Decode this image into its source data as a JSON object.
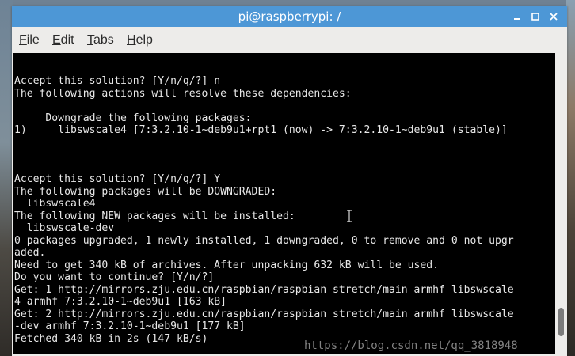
{
  "window": {
    "title": "pi@raspberrypi: /"
  },
  "menu": {
    "items": [
      {
        "mnemonic": "F",
        "rest": "ile"
      },
      {
        "mnemonic": "E",
        "rest": "dit"
      },
      {
        "mnemonic": "T",
        "rest": "abs"
      },
      {
        "mnemonic": "H",
        "rest": "elp"
      }
    ]
  },
  "terminal": {
    "lines": [
      "Accept this solution? [Y/n/q/?] n",
      "The following actions will resolve these dependencies:",
      "",
      "     Downgrade the following packages:",
      "1)     libswscale4 [7:3.2.10-1~deb9u1+rpt1 (now) -> 7:3.2.10-1~deb9u1 (stable)]",
      "",
      "",
      "",
      "Accept this solution? [Y/n/q/?] Y",
      "The following packages will be DOWNGRADED:",
      "  libswscale4",
      "The following NEW packages will be installed:",
      "  libswscale-dev",
      "0 packages upgraded, 1 newly installed, 1 downgraded, 0 to remove and 0 not upgr",
      "aded.",
      "Need to get 340 kB of archives. After unpacking 632 kB will be used.",
      "Do you want to continue? [Y/n/?]",
      "Get: 1 http://mirrors.zju.edu.cn/raspbian/raspbian stretch/main armhf libswscale",
      "4 armhf 7:3.2.10-1~deb9u1 [163 kB]",
      "Get: 2 http://mirrors.zju.edu.cn/raspbian/raspbian stretch/main armhf libswscale",
      "-dev armhf 7:3.2.10-1~deb9u1 [177 kB]",
      "Fetched 340 kB in 2s (147 kB/s)"
    ],
    "scroll_position": 0.95
  },
  "watermark": {
    "text": "https://blog.csdn.net/qq_3818948"
  },
  "colors": {
    "titlebar": "#4d97d6",
    "terminal_bg": "#000000",
    "terminal_fg": "#e8e8e8"
  },
  "icons": {
    "minimize": "minimize-icon",
    "maximize": "maximize-icon",
    "close": "close-icon",
    "cursor": "text-cursor-icon"
  }
}
